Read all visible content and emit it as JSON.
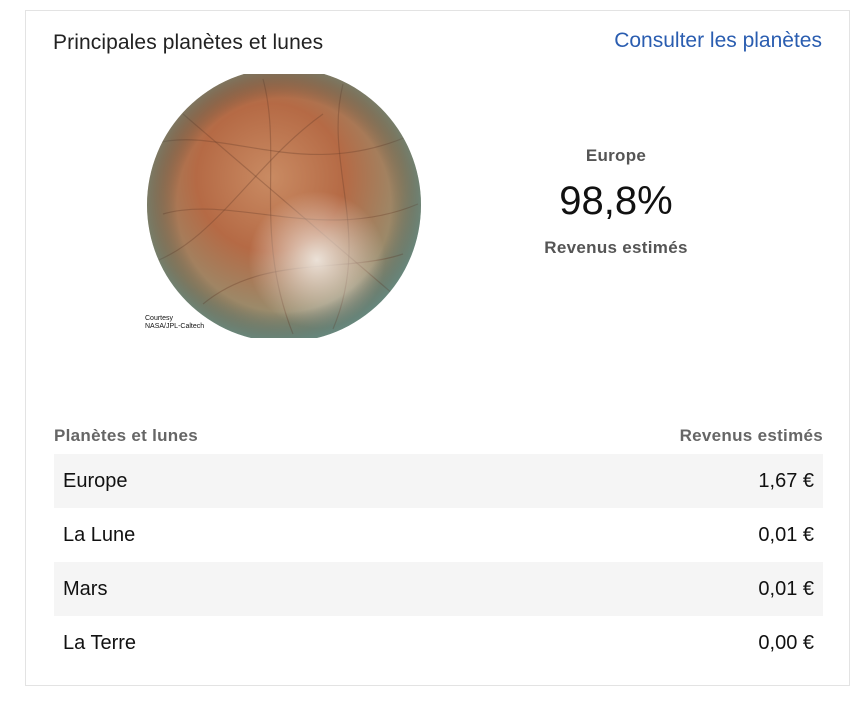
{
  "card": {
    "title": "Principales planètes et lunes",
    "link": "Consulter les planètes",
    "image": {
      "credit_line1": "Courtesy",
      "credit_line2": "NASA/JPL-Caltech"
    },
    "highlight": {
      "name": "Europe",
      "value": "98,8%",
      "caption": "Revenus estimés"
    },
    "table": {
      "headers": [
        "Planètes et lunes",
        "Revenus estimés"
      ],
      "rows": [
        {
          "name": "Europe",
          "value": "1,67 €"
        },
        {
          "name": "La Lune",
          "value": "0,01 €"
        },
        {
          "name": "Mars",
          "value": "0,01 €"
        },
        {
          "name": "La Terre",
          "value": "0,00 €"
        }
      ]
    }
  },
  "colors": {
    "link": "#2a5db0",
    "row_shade": "#f5f5f5",
    "border": "#e3e3e3"
  }
}
